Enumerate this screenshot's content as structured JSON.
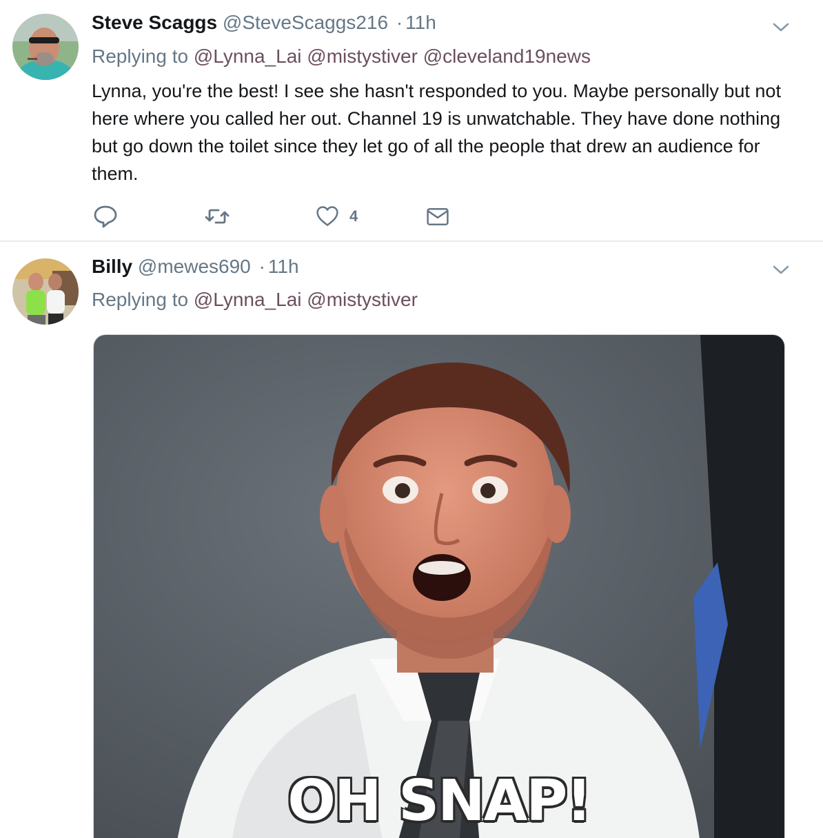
{
  "tweets": [
    {
      "name": "Steve Scaggs",
      "handle": "@SteveScaggs216",
      "dot": "·",
      "time": "11h",
      "replying_prefix": "Replying to",
      "mentions": [
        "@Lynna_Lai",
        "@mistystiver",
        "@cleveland19news"
      ],
      "text": "Lynna, you're the best! I see she hasn't responded to you. Maybe personally but not here where you called her out. Channel 19 is unwatchable. They have done nothing but go down the toilet since they let go of all the people that drew an audience for them.",
      "like_count": "4"
    },
    {
      "name": "Billy",
      "handle": "@mewes690",
      "dot": "·",
      "time": "11h",
      "replying_prefix": "Replying to",
      "mentions": [
        "@Lynna_Lai",
        "@mistystiver"
      ],
      "media_caption": "OH SNAP!"
    }
  ],
  "colors": {
    "text": "#14171a",
    "secondary": "#657786",
    "mention": "#6b4f5e",
    "divider": "#e6ecf0"
  },
  "icons": {
    "reply": "reply-icon",
    "retweet": "retweet-icon",
    "like": "heart-icon",
    "dm": "envelope-icon",
    "more": "chevron-down-icon"
  }
}
